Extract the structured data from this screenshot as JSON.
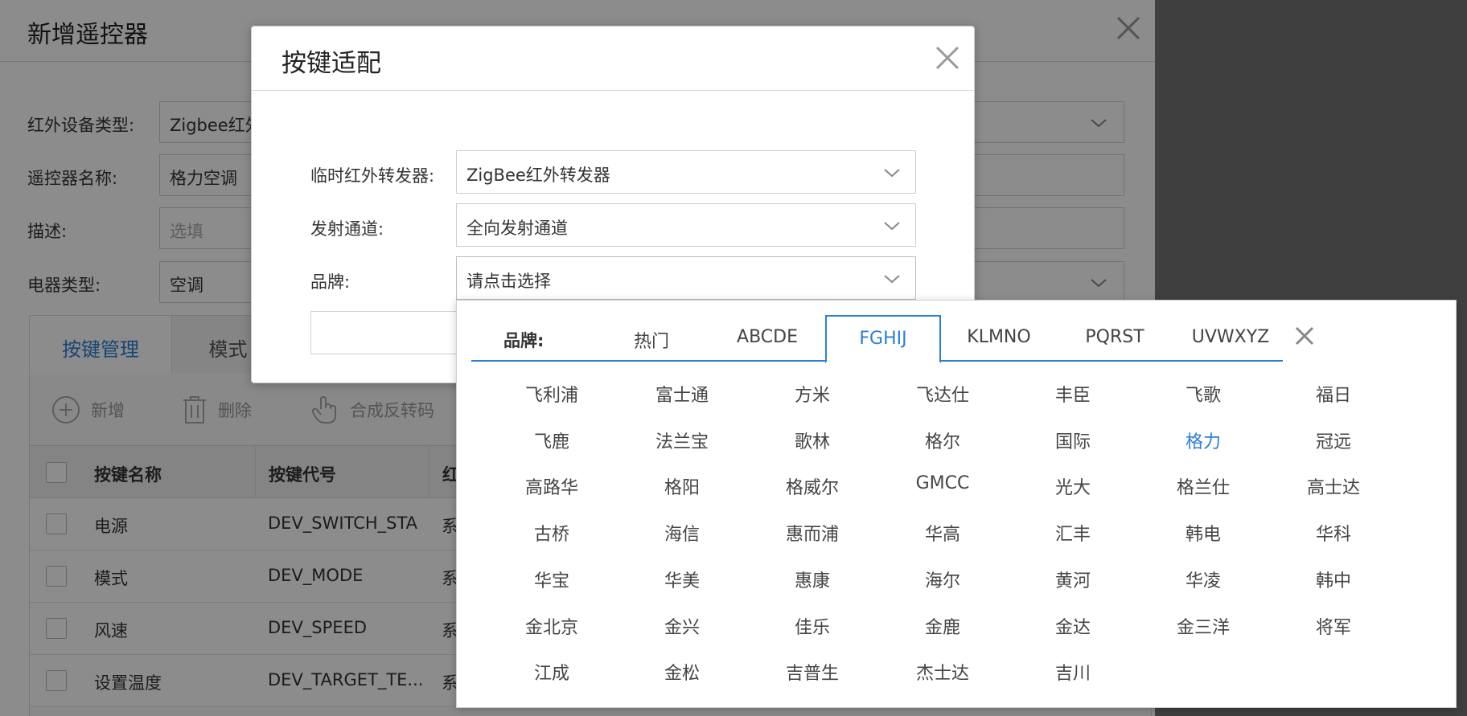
{
  "outer": {
    "title": "新增遥控器",
    "fields": [
      {
        "label": "红外设备类型:",
        "value": "Zigbee红外",
        "placeholder": false,
        "dropdown": true
      },
      {
        "label": "遥控器名称:",
        "value": "格力空调",
        "placeholder": false,
        "dropdown": false
      },
      {
        "label": "描述:",
        "value": "选填",
        "placeholder": true,
        "dropdown": false
      },
      {
        "label": "电器类型:",
        "value": "空调",
        "placeholder": false,
        "dropdown": true
      }
    ],
    "tabs": [
      {
        "label": "按键管理",
        "active": true
      },
      {
        "label": "模式",
        "active": false
      }
    ],
    "toolbar": {
      "add_label": "新增",
      "delete_label": "删除",
      "synth_label": "合成反转码"
    },
    "table": {
      "columns": [
        "按键名称",
        "按键代号",
        "红"
      ],
      "rows": [
        {
          "name": "电源",
          "code": "DEV_SWITCH_STA",
          "extra": "系"
        },
        {
          "name": "模式",
          "code": "DEV_MODE",
          "extra": "系"
        },
        {
          "name": "风速",
          "code": "DEV_SPEED",
          "extra": "系"
        },
        {
          "name": "设置温度",
          "code": "DEV_TARGET_TE...",
          "extra": "系"
        }
      ]
    }
  },
  "modal": {
    "title": "按键适配",
    "fields": [
      {
        "label": "临时红外转发器:",
        "value": "ZigBee红外转发器"
      },
      {
        "label": "发射通道:",
        "value": "全向发射通道"
      },
      {
        "label": "品牌:",
        "value": "请点击选择"
      }
    ]
  },
  "brand_panel": {
    "label": "品牌:",
    "tabs": [
      {
        "label": "热门",
        "active": false
      },
      {
        "label": "ABCDE",
        "active": false
      },
      {
        "label": "FGHIJ",
        "active": true
      },
      {
        "label": "KLMNO",
        "active": false
      },
      {
        "label": "PQRST",
        "active": false
      },
      {
        "label": "UVWXYZ",
        "active": false
      }
    ],
    "selected_brand": "格力",
    "brands": [
      "飞利浦",
      "富士通",
      "方米",
      "飞达仕",
      "丰臣",
      "飞歌",
      "福日",
      "飞鹿",
      "法兰宝",
      "歌林",
      "格尔",
      "国际",
      "格力",
      "冠远",
      "高路华",
      "格阳",
      "格威尔",
      "GMCC",
      "光大",
      "格兰仕",
      "高士达",
      "古桥",
      "海信",
      "惠而浦",
      "华高",
      "汇丰",
      "韩电",
      "华科",
      "华宝",
      "华美",
      "惠康",
      "海尔",
      "黄河",
      "华凌",
      "韩中",
      "金北京",
      "金兴",
      "佳乐",
      "金鹿",
      "金达",
      "金三洋",
      "将军",
      "江成",
      "金松",
      "吉普生",
      "杰士达",
      "吉川"
    ]
  },
  "colors": {
    "accent": "#2b7fd6",
    "overlay": "rgba(0,0,0,0.45)",
    "right_bg": "#3f3f3f"
  }
}
